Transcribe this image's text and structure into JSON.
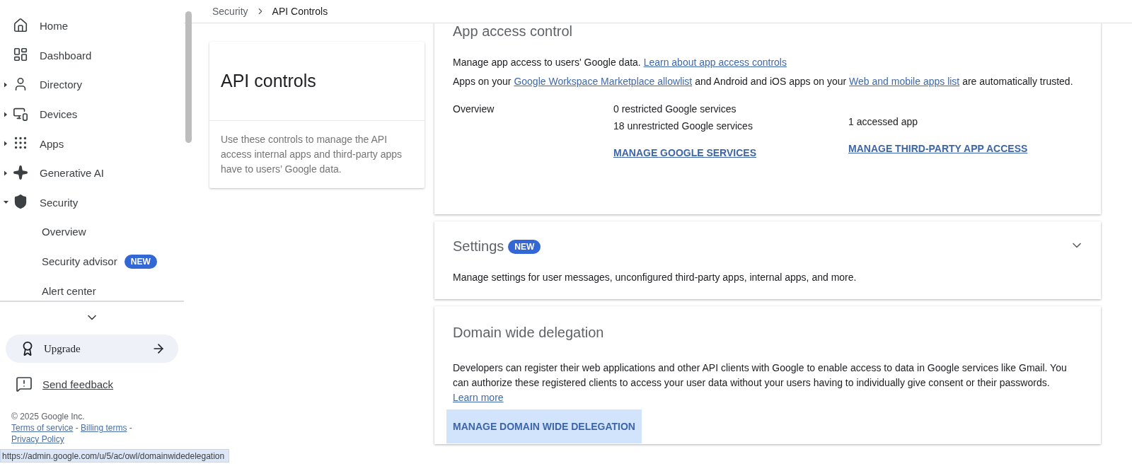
{
  "sidebar": {
    "items": [
      {
        "label": "Home"
      },
      {
        "label": "Dashboard"
      },
      {
        "label": "Directory",
        "expanded": false
      },
      {
        "label": "Devices",
        "expanded": false
      },
      {
        "label": "Apps",
        "expanded": false
      },
      {
        "label": "Generative AI",
        "expanded": false
      },
      {
        "label": "Security",
        "expanded": true,
        "children": [
          {
            "label": "Overview"
          },
          {
            "label": "Security advisor",
            "badge": "NEW"
          },
          {
            "label": "Alert center"
          }
        ]
      }
    ],
    "upgrade": "Upgrade",
    "feedback": "Send feedback",
    "footer": {
      "copyright": "© 2025 Google Inc.",
      "links": [
        {
          "text": "Terms of service",
          "kind": "link"
        },
        {
          "text": "-",
          "kind": "separator"
        },
        {
          "text": "Billing terms",
          "kind": "link"
        },
        {
          "text": "-",
          "kind": "separator"
        },
        {
          "text": "Privacy Policy",
          "kind": "link"
        }
      ]
    }
  },
  "breadcrumb": [
    "Security",
    "API Controls"
  ],
  "intro_card": {
    "title": "API controls",
    "description": "Use these controls to manage the API access internal apps and third-party apps have to users’ Google data."
  },
  "sections": [
    {
      "kind": "overview",
      "title": "App access control",
      "paragraphs": [
        [
          {
            "text": "Manage app access to users' Google data. "
          },
          {
            "text": "Learn about app access controls",
            "link": true
          }
        ],
        [
          {
            "text": "Apps on your "
          },
          {
            "text": "Google Workspace Marketplace allowlist",
            "link": true
          },
          {
            "text": " and Android and iOS apps on your "
          },
          {
            "text": "Web and mobile apps list",
            "link": true
          },
          {
            "text": " are automatically trusted."
          }
        ]
      ],
      "overview_label": "Overview",
      "columns": [
        {
          "lines": [
            "0 restricted Google services",
            "18 unrestricted Google services"
          ],
          "action": "MANAGE GOOGLE SERVICES"
        },
        {
          "lines": [
            "1 accessed app"
          ],
          "action": "MANAGE THIRD-PARTY APP ACCESS"
        }
      ]
    },
    {
      "kind": "collapsible",
      "title": "Settings",
      "badge": "NEW",
      "expanded": false,
      "paragraphs": [
        [
          {
            "text": "Manage settings for user messages, unconfigured third-party apps, internal apps, and more."
          }
        ]
      ]
    },
    {
      "kind": "action",
      "title": "Domain wide delegation",
      "paragraphs": [
        [
          {
            "text": "Developers can register their web applications and other API clients with Google to enable access to data in Google services like Gmail. You can authorize these registered clients to access your user data without your users having to individually give consent or their passwords. "
          },
          {
            "text": "Learn more",
            "link": true
          }
        ]
      ],
      "action": "MANAGE DOMAIN WIDE DELEGATION",
      "hovered": true
    }
  ],
  "status_url": "https://admin.google.com/u/5/ac/owl/domainwidedelegation"
}
